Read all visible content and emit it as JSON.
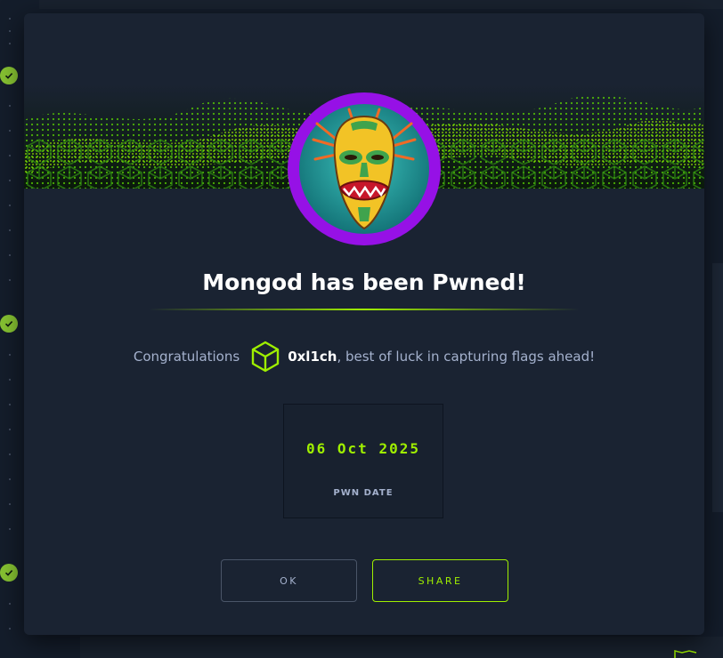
{
  "modal": {
    "title": "Mongod has been Pwned!",
    "congrats_prefix": "Congratulations",
    "username": "0xl1ch",
    "congrats_suffix": ", best of luck in capturing flags ahead!",
    "pwn_date_value": "06 Oct 2025",
    "pwn_date_label": "PWN DATE",
    "ok_label": "OK",
    "share_label": "SHARE"
  },
  "icons": {
    "cube": "cube-icon",
    "check": "check-icon",
    "avatar": "tiki-mask-avatar"
  },
  "colors": {
    "accent": "#9fef00",
    "avatar_ring": "#9611e6",
    "check_badge": "#86c232",
    "background": "#141d2b",
    "modal": "#1a2332"
  }
}
